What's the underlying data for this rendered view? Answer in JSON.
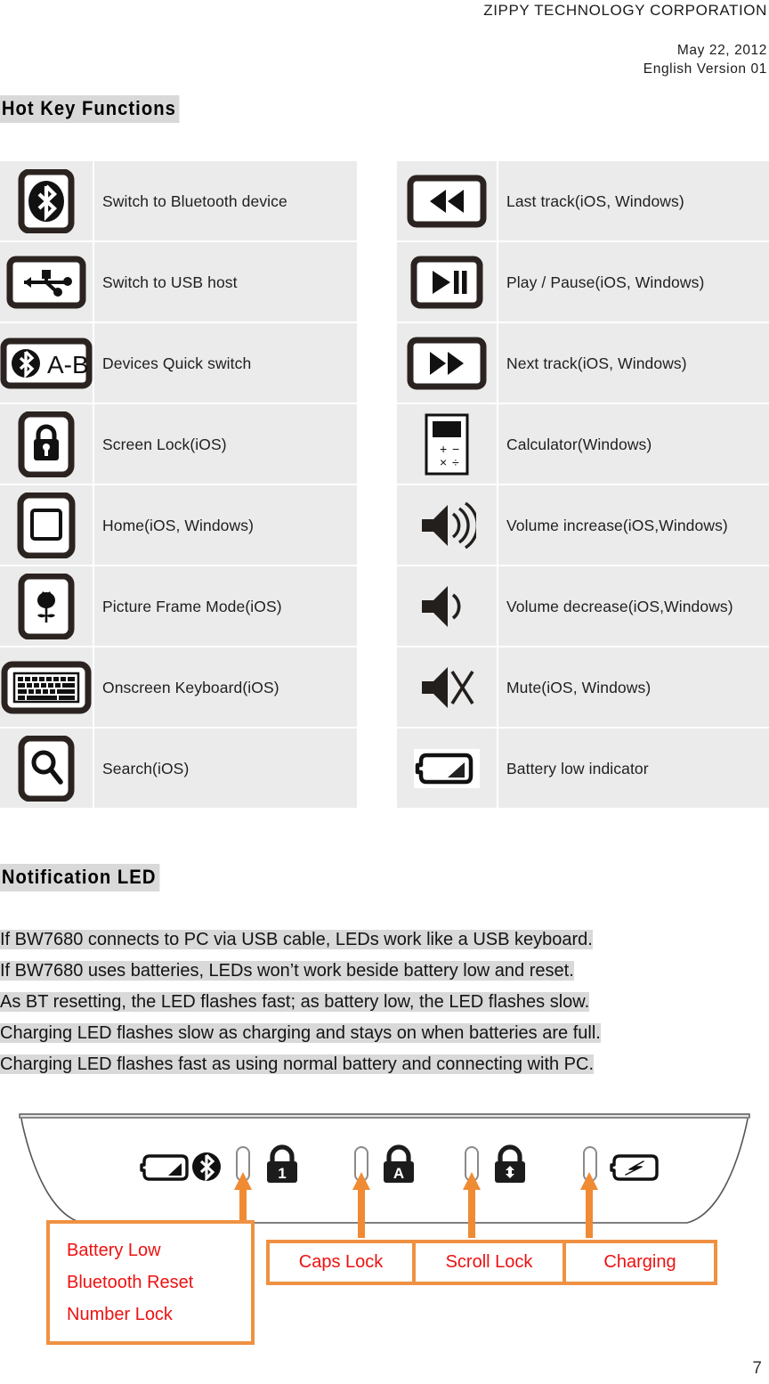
{
  "header": {
    "company": "ZIPPY TECHNOLOGY CORPORATION",
    "date": "May 22, 2012",
    "version": "English Version 01"
  },
  "sections": {
    "hotkey_heading": "Hot Key Functions",
    "led_heading": "Notification LED"
  },
  "hotkeys_left": [
    {
      "icon": "bluetooth-key-icon",
      "label": "Switch to Bluetooth device"
    },
    {
      "icon": "usb-host-key-icon",
      "label": "Switch to USB host"
    },
    {
      "icon": "bluetooth-ab-key-icon",
      "label": "Devices Quick switch"
    },
    {
      "icon": "screen-lock-key-icon",
      "label": "Screen Lock(iOS)"
    },
    {
      "icon": "home-key-icon",
      "label": "Home(iOS, Windows)"
    },
    {
      "icon": "picture-frame-key-icon",
      "label": "Picture Frame Mode(iOS)"
    },
    {
      "icon": "onscreen-keyboard-key-icon",
      "label": "Onscreen Keyboard(iOS)"
    },
    {
      "icon": "search-key-icon",
      "label": "Search(iOS)"
    }
  ],
  "hotkeys_right": [
    {
      "icon": "previous-track-key-icon",
      "label": "Last track(iOS, Windows)"
    },
    {
      "icon": "play-pause-key-icon",
      "label": "Play / Pause(iOS, Windows)"
    },
    {
      "icon": "next-track-key-icon",
      "label": "Next track(iOS, Windows)"
    },
    {
      "icon": "calculator-key-icon",
      "label": "Calculator(Windows)"
    },
    {
      "icon": "volume-up-icon",
      "label": "Volume  increase(iOS,Windows)"
    },
    {
      "icon": "volume-down-icon",
      "label": "Volume decrease(iOS,Windows)"
    },
    {
      "icon": "mute-icon",
      "label": "Mute(iOS, Windows)"
    },
    {
      "icon": "battery-low-icon",
      "label": "Battery low indicator"
    }
  ],
  "led_notes": [
    "If BW7680 connects to PC via USB cable, LEDs work like a USB keyboard.",
    "If BW7680 uses batteries, LEDs won’t work beside battery low and reset.",
    "As BT resetting, the LED flashes fast; as battery low, the LED flashes slow.",
    "Charging LED flashes slow as charging and stays on when batteries are full.",
    "Charging LED flashes fast as using normal battery and connecting with PC."
  ],
  "diagram": {
    "indicator_icons": [
      "battery-low-icon",
      "bluetooth-icon",
      "led-slot-icon",
      "number-lock-icon",
      "led-slot-icon",
      "caps-lock-icon",
      "led-slot-icon",
      "scroll-lock-icon",
      "led-slot-icon",
      "charging-icon"
    ],
    "callout_left": [
      "Battery Low",
      "Bluetooth Reset",
      "Number Lock"
    ],
    "callout_caps": "Caps Lock",
    "callout_scroll": "Scroll Lock",
    "callout_charging": "Charging",
    "callout_border_color": "#ef9142",
    "callout_text_color": "#ee1111"
  },
  "page_number": "7"
}
